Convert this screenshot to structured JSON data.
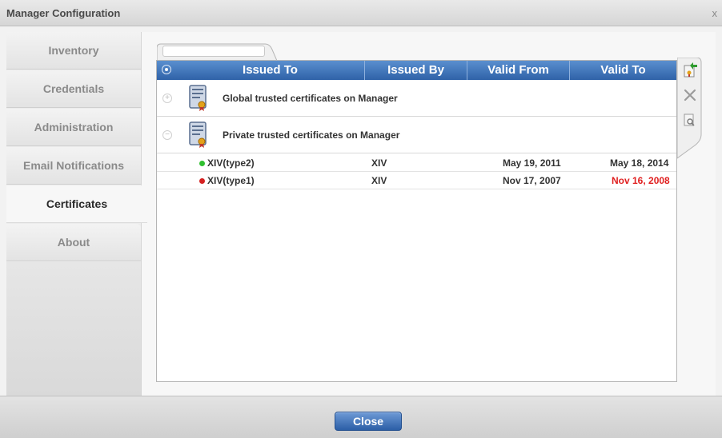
{
  "window": {
    "title": "Manager Configuration",
    "close_glyph": "x"
  },
  "sidebar": {
    "items": [
      {
        "label": "Inventory",
        "active": false
      },
      {
        "label": "Credentials",
        "active": false
      },
      {
        "label": "Administration",
        "active": false
      },
      {
        "label": "Email Notifications",
        "active": false
      },
      {
        "label": "Certificates",
        "active": true
      },
      {
        "label": "About",
        "active": false
      }
    ]
  },
  "search": {
    "value": "",
    "placeholder": ""
  },
  "table": {
    "columns": [
      "Issued To",
      "Issued By",
      "Valid From",
      "Valid To"
    ],
    "groups": [
      {
        "label": "Global trusted certificates on Manager",
        "expanded": false
      },
      {
        "label": "Private trusted certificates on Manager",
        "expanded": true
      }
    ],
    "rows": [
      {
        "issued_to": "XIV(type2)",
        "issued_by": "XIV",
        "valid_from": "May 19, 2011",
        "valid_to": "May 18, 2014",
        "status_color": "#2fbf2f",
        "valid_to_color": "#333333"
      },
      {
        "issued_to": "XIV(type1)",
        "issued_by": "XIV",
        "valid_from": "Nov 17, 2007",
        "valid_to": "Nov 16, 2008",
        "status_color": "#d42020",
        "valid_to_color": "#e02020"
      }
    ]
  },
  "tools": [
    "import-certificate-icon",
    "delete-icon",
    "view-details-icon"
  ],
  "footer": {
    "close_label": "Close"
  },
  "colors": {
    "header_blue": "#2f62a8",
    "expired_red": "#e02020"
  }
}
